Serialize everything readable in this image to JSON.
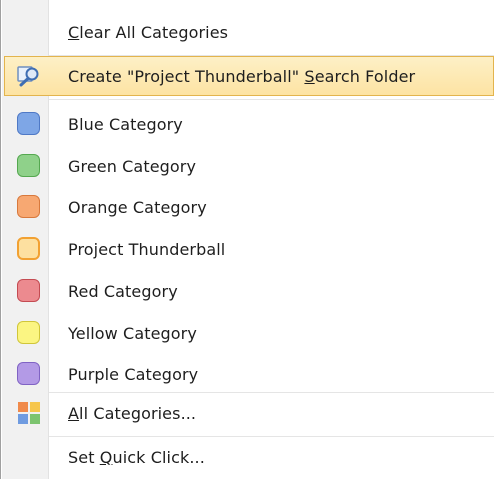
{
  "menu": {
    "clear": {
      "pre": "",
      "u": "C",
      "post": "lear All Categories"
    },
    "search": {
      "pre": "Create \"Project Thunderball\" ",
      "u": "S",
      "post": "earch Folder"
    },
    "categories": [
      {
        "label": "Blue Category",
        "color": "#7ea6e6",
        "edge": "#4f79c6"
      },
      {
        "label": "Green Category",
        "color": "#8fd18a",
        "edge": "#55a850"
      },
      {
        "label": "Orange Category",
        "color": "#f7a872",
        "edge": "#d8793d"
      },
      {
        "label": "Project Thunderball",
        "color": "#fde0a0",
        "edge": "#e8a73f",
        "selected": true
      },
      {
        "label": "Red Category",
        "color": "#ec8a8f",
        "edge": "#c44b52"
      },
      {
        "label": "Yellow Category",
        "color": "#fbf582",
        "edge": "#d0c63a"
      },
      {
        "label": "Purple Category",
        "color": "#b39ae6",
        "edge": "#8063c4"
      }
    ],
    "all": {
      "pre": "",
      "u": "A",
      "post": "ll Categories..."
    },
    "quick": {
      "pre": "Set ",
      "u": "Q",
      "post": "uick Click..."
    }
  }
}
